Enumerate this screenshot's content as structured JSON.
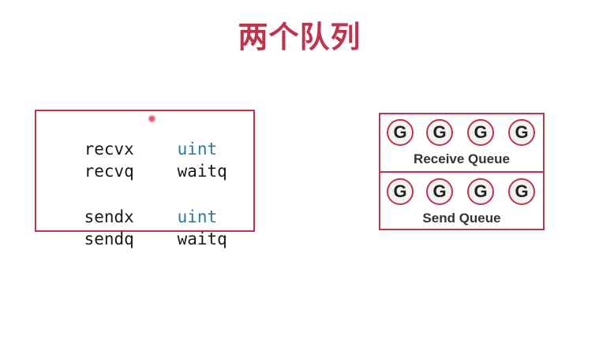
{
  "title": "两个队列",
  "code": [
    {
      "field": "recvx",
      "type": "uint"
    },
    {
      "field": "recvq",
      "type": "waitq"
    },
    {
      "field": "sendx",
      "type": "uint"
    },
    {
      "field": "sendq",
      "type": "waitq"
    }
  ],
  "queues": {
    "receive": {
      "label": "Receive Queue",
      "items": [
        "G",
        "G",
        "G",
        "G"
      ]
    },
    "send": {
      "label": "Send Queue",
      "items": [
        "G",
        "G",
        "G",
        "G"
      ]
    }
  },
  "colors": {
    "accent": "#c0334d",
    "type_uint": "#2b7a9b",
    "text": "#1a1a1a"
  }
}
